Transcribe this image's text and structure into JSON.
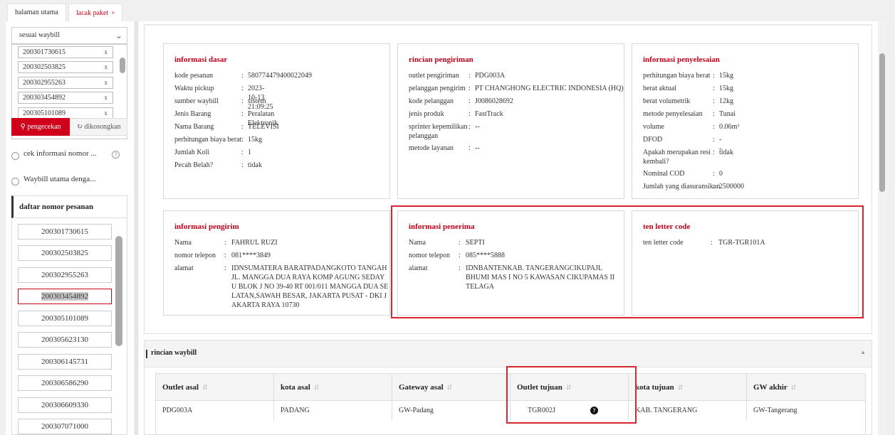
{
  "tabs": [
    {
      "label": "halaman utama"
    },
    {
      "label": "lacak paket",
      "close": "×"
    }
  ],
  "left": {
    "search_mode": "sesuai waybill",
    "waybill_inputs": [
      "200301730615",
      "200302503825",
      "200302955263",
      "200303454892",
      "200305101089"
    ],
    "remove_glyph": "x",
    "search_button": "pengecekan",
    "clear_button": "dikosongkan",
    "radio_1": "cek informasi nomor ...",
    "radio_2": "Waybill utama denga...",
    "order_list_title": "daftar nomor pesanan",
    "order_list": [
      "200301730615",
      "200302503825",
      "200302955263",
      "200303454892",
      "200305101089",
      "200305623130",
      "200306145731",
      "200306586290",
      "200306609330",
      "200307071000"
    ],
    "selected_order": "200303454892"
  },
  "cards": {
    "dasar": {
      "title": "informasi dasar",
      "rows": [
        [
          "kode pesanan",
          "580774479400022049"
        ],
        [
          "Waktu pickup",
          "2023-10-13 21:09:25"
        ],
        [
          "sumber waybill",
          "sistem"
        ],
        [
          "Jenis Barang",
          "Peralatan Elektronik"
        ],
        [
          "Nama Barang",
          "TELEVISI"
        ],
        [
          "perhitungan biaya berat",
          "15kg"
        ],
        [
          "Jumlah Koli",
          "1"
        ],
        [
          "Pecah Belah?",
          "tidak"
        ]
      ]
    },
    "pengiriman": {
      "title": "rincian pengiriman",
      "rows": [
        [
          "outlet pengiriman",
          "PDG003A"
        ],
        [
          "pelanggan pengirim",
          "PT CHANGHONG ELECTRIC INDONESIA (HQ)"
        ],
        [
          "kode pelanggan",
          "J0086028692"
        ],
        [
          "jenis produk",
          "FastTrack"
        ],
        [
          "sprinter kepemilikan pelanggan",
          "--"
        ],
        [
          "metode layanan",
          "--"
        ]
      ]
    },
    "penyelesaian": {
      "title": "informasi penyelesaian",
      "rows": [
        [
          "perhitungan biaya berat",
          "15kg"
        ],
        [
          "berat aktual",
          "15kg"
        ],
        [
          "berat volumetrik",
          "12kg"
        ],
        [
          "metode penyelesaian",
          "Tunai"
        ],
        [
          "volume",
          "0.06m³"
        ],
        [
          "DFOD",
          "--"
        ],
        [
          "Apakah merupakan resi kembali?",
          "tidak"
        ],
        [
          "Nominal COD",
          "0"
        ],
        [
          "Jumlah yang diasuransikan",
          "2500000"
        ]
      ]
    },
    "pengirim": {
      "title": "informasi pengirim",
      "rows": [
        [
          "Nama",
          "FAHRUL RUZI"
        ],
        [
          "nomor telepon",
          "081****3849"
        ],
        [
          "alamat",
          "IDNSUMATERA BARATPADANGKOTO TANGAHJL. MANGGA DUA RAYA KOMP AGUNG SEDAYU BLOK J NO 39-40 RT 001/011 MANGGA DUA SELATAN,SAWAH BESAR, JAKARTA PUSAT - DKI JAKARTA RAYA 10730"
        ]
      ]
    },
    "penerima": {
      "title": "informasi penerima",
      "rows": [
        [
          "Nama",
          "SEPTI"
        ],
        [
          "nomor telepon",
          "085****5888"
        ],
        [
          "alamat",
          "IDNBANTENKAB. TANGERANGCIKUPAJL BHUMI MAS I NO 5 KAWASAN CIKUPAMAS II TELAGA"
        ]
      ]
    },
    "tlc": {
      "title": "ten letter code",
      "rows": [
        [
          "ten letter code",
          "TGR-TGR101A"
        ]
      ]
    }
  },
  "waybill": {
    "title": "rincian waybill",
    "columns": [
      "Outlet asal",
      "kota asal",
      "Gateway asal",
      "Outlet tujuan",
      "kota tujuan",
      "GW akhir"
    ],
    "row": [
      "PDG003A",
      "PADANG",
      "GW-Padang",
      "TGR002J",
      "KAB. TANGERANG",
      "GW-Tangerang"
    ],
    "help_glyph": "?"
  },
  "colors": {
    "accent": "#d0021b",
    "highlight_box": "#d6262f"
  },
  "icons": {
    "search": "search-icon",
    "clear": "clear-icon",
    "chevron": "chevron-down-icon",
    "help": "help-icon",
    "sort": "sort-icon",
    "collapse": "collapse-icon"
  }
}
